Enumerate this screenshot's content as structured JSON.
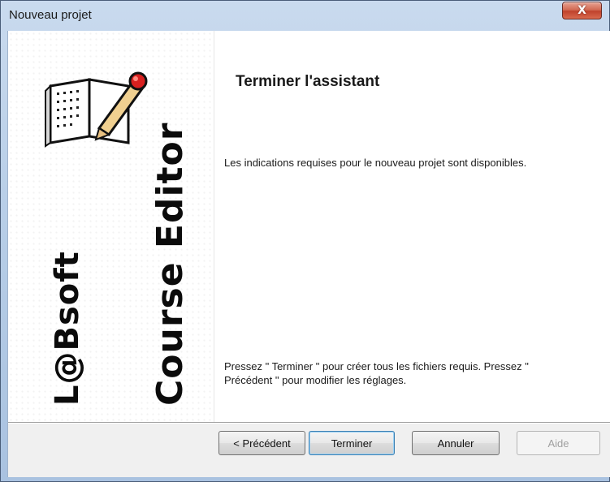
{
  "window": {
    "title": "Nouveau projet",
    "close_glyph": "X"
  },
  "banner": {
    "logo_icon": "book-with-pencil-icon",
    "vertical_text_1": "L@Bsoft",
    "vertical_text_2": "Course Editor"
  },
  "page": {
    "heading": "Terminer l'assistant",
    "text1": "Les indications requises pour le nouveau projet sont disponibles.",
    "text2": "Pressez \" Terminer \" pour créer tous les fichiers requis. Pressez \" Précédent \" pour modifier les réglages."
  },
  "buttons": {
    "prev": "< Précédent",
    "finish": "Terminer",
    "cancel": "Annuler",
    "help": "Aide"
  },
  "colors": {
    "close_button": "#c8503a",
    "default_button_border": "#3c7fb1",
    "disabled_text": "#a0a0a0"
  }
}
